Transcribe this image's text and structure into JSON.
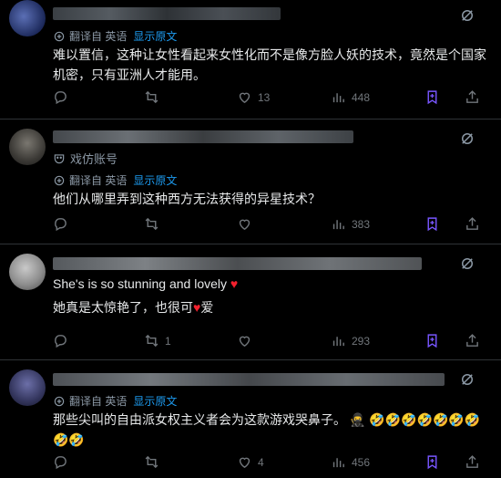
{
  "translate": {
    "label": "翻译自 英语",
    "show_original": "显示原文"
  },
  "posts": [
    {
      "text_lines": [
        "难以置信，这种让女性看起来女性化而不是像方脸人妖的技术，竟然是个国家",
        "机密，只有亚洲人才能用。"
      ],
      "replies": "",
      "reposts": "",
      "likes": "13",
      "views": "448"
    },
    {
      "role_label": "戏仿账号",
      "text_lines": [
        "他们从哪里弄到这种西方无法获得的异星技术？"
      ],
      "replies": "",
      "reposts": "",
      "likes": "",
      "views": "383"
    },
    {
      "original_text": "She's is so stunning and lovely",
      "translated_prefix": "她真是太惊艳了，也很可",
      "translated_suffix": "爱",
      "replies": "",
      "reposts": "1",
      "likes": "",
      "views": "293"
    },
    {
      "text_line1": "那些尖叫的自由派女权主义者会为这款游戏哭鼻子。",
      "emoji_line1": "🥷 🤣🤣🤣🤣🤣🤣🤣",
      "emoji_line2": "🤣🤣",
      "replies": "",
      "reposts": "",
      "likes": "4",
      "views": "456"
    }
  ],
  "colors": {
    "accent": "#1d9bf0",
    "bookmark": "#7856ff",
    "heart": "#f4212e"
  },
  "icons": [
    "grok-icon",
    "translate-icon",
    "reply-icon",
    "repost-icon",
    "like-icon",
    "views-icon",
    "bookmark-icon",
    "share-icon",
    "parody-mask-icon",
    "heart-emoji"
  ]
}
